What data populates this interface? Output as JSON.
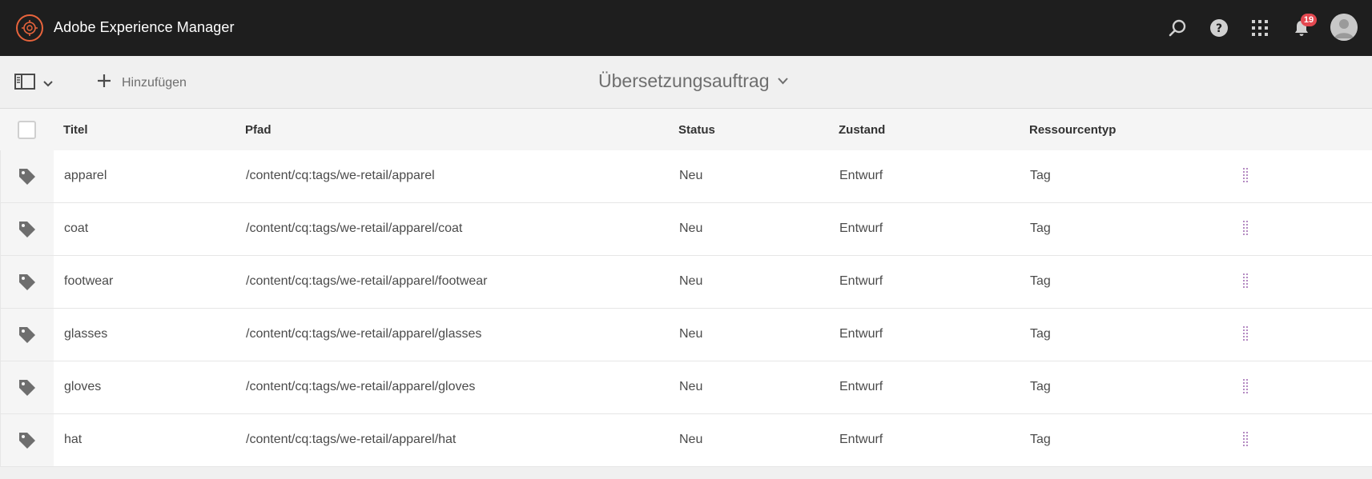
{
  "shell": {
    "app_title": "Adobe Experience Manager",
    "notification_count": "19",
    "accent_color": "#e8643c",
    "badge_color": "#e34850",
    "icons": [
      "search-icon",
      "help-icon",
      "apps-grid-icon",
      "bell-icon",
      "user-avatar"
    ]
  },
  "actionbar": {
    "add_label": "Hinzufügen",
    "page_title": "Übersetzungsauftrag"
  },
  "table": {
    "headers": {
      "title": "Titel",
      "path": "Pfad",
      "status": "Status",
      "state": "Zustand",
      "resource_type": "Ressourcentyp"
    },
    "rows": [
      {
        "title": "apparel",
        "path": "/content/cq:tags/we-retail/apparel",
        "status": "Neu",
        "state": "Entwurf",
        "type": "Tag"
      },
      {
        "title": "coat",
        "path": "/content/cq:tags/we-retail/apparel/coat",
        "status": "Neu",
        "state": "Entwurf",
        "type": "Tag"
      },
      {
        "title": "footwear",
        "path": "/content/cq:tags/we-retail/apparel/footwear",
        "status": "Neu",
        "state": "Entwurf",
        "type": "Tag"
      },
      {
        "title": "glasses",
        "path": "/content/cq:tags/we-retail/apparel/glasses",
        "status": "Neu",
        "state": "Entwurf",
        "type": "Tag"
      },
      {
        "title": "gloves",
        "path": "/content/cq:tags/we-retail/apparel/gloves",
        "status": "Neu",
        "state": "Entwurf",
        "type": "Tag"
      },
      {
        "title": "hat",
        "path": "/content/cq:tags/we-retail/apparel/hat",
        "status": "Neu",
        "state": "Entwurf",
        "type": "Tag"
      }
    ]
  }
}
